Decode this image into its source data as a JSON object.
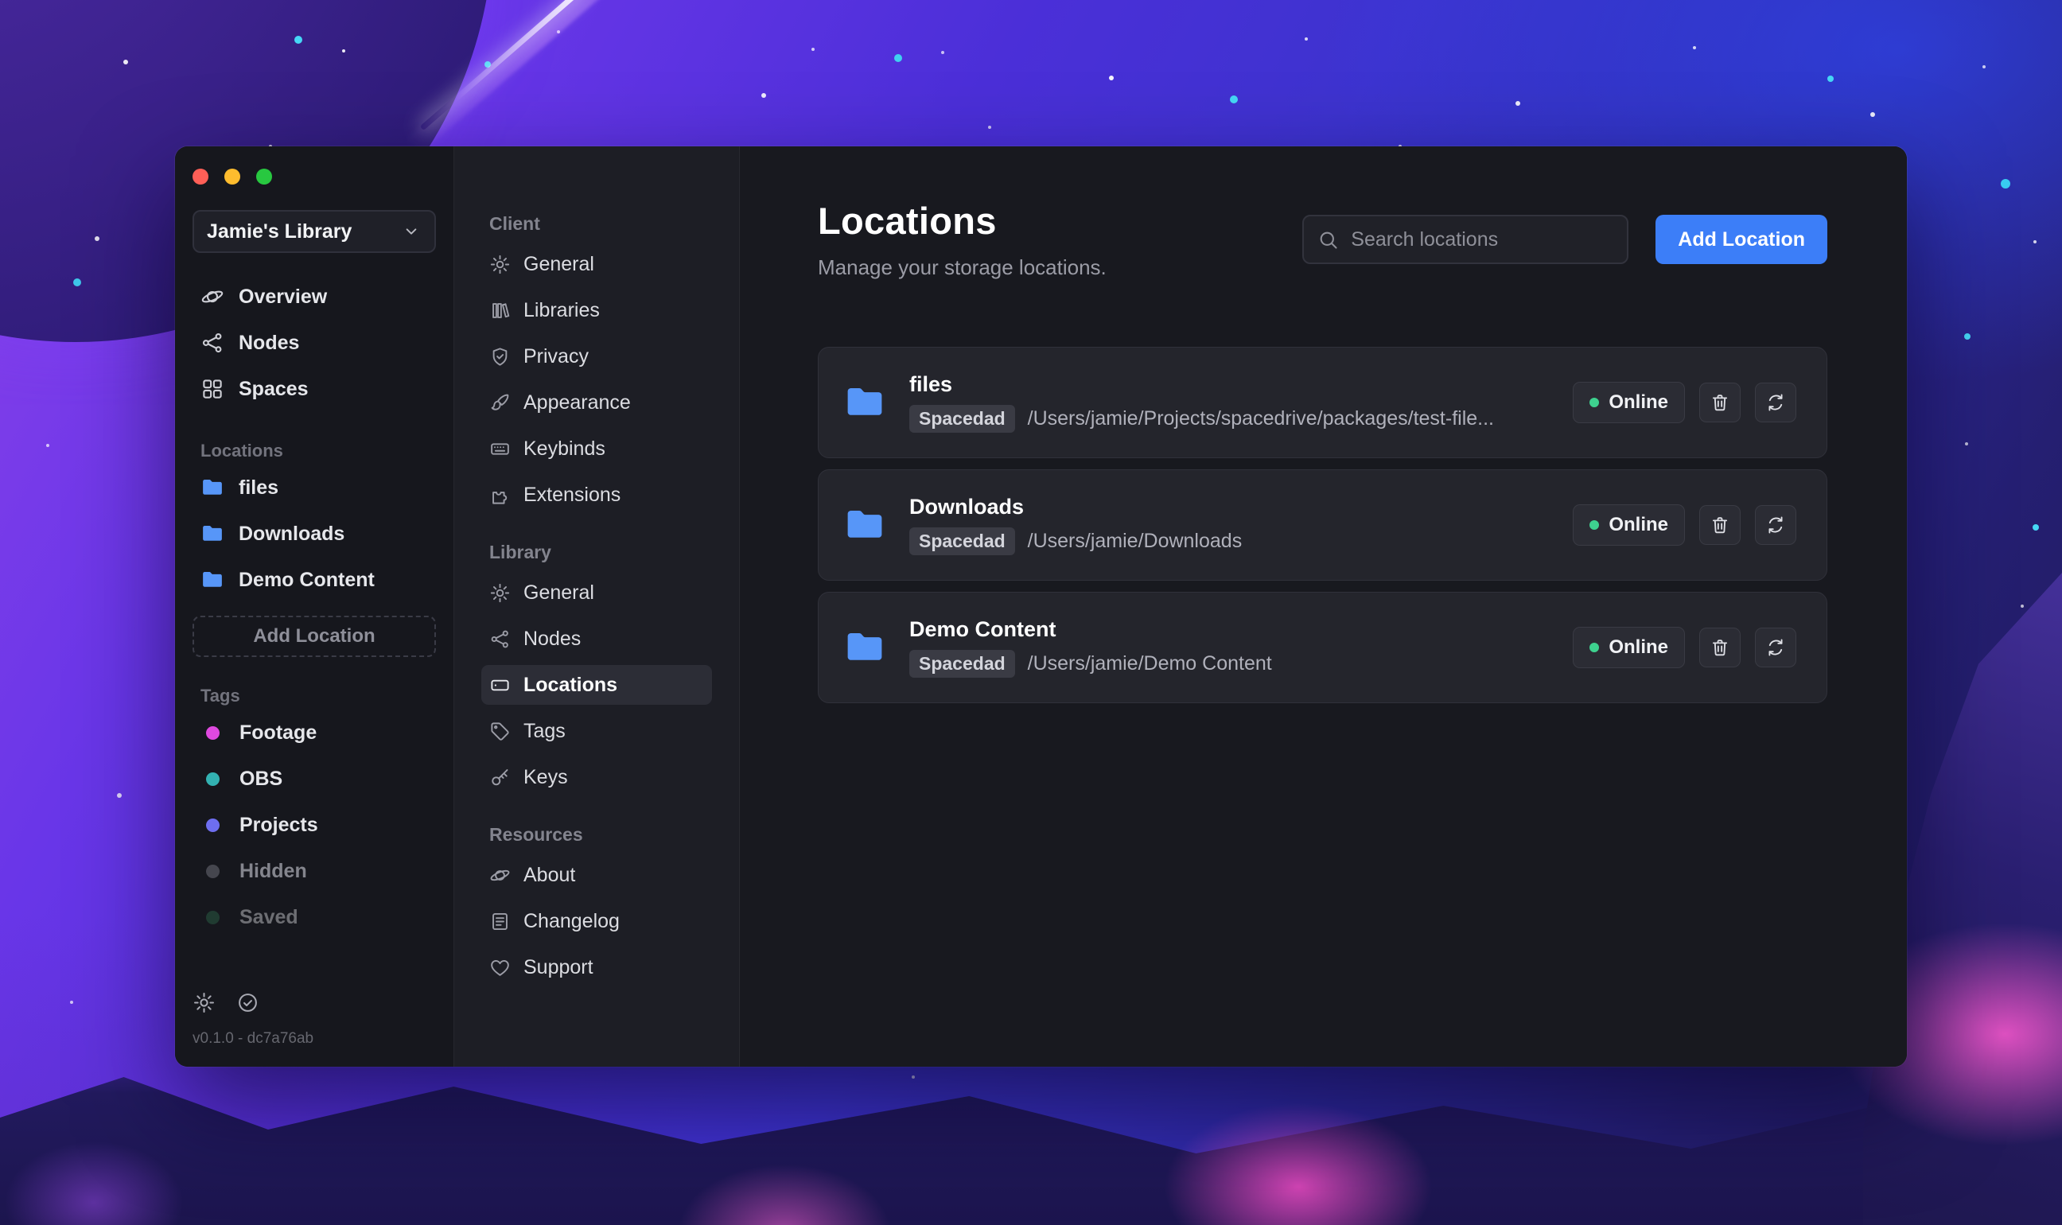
{
  "colors": {
    "accent": "#3c7ef8",
    "online_green": "#3ed18f",
    "folder_blue": "#5796f8",
    "traffic_red": "#ff5f57",
    "traffic_yellow": "#febc2e",
    "traffic_green": "#28c840"
  },
  "window": {
    "sidebar": {
      "library_selector": "Jamie's Library",
      "nav": [
        {
          "label": "Overview",
          "icon": "planet"
        },
        {
          "label": "Nodes",
          "icon": "nodes"
        },
        {
          "label": "Spaces",
          "icon": "grid"
        }
      ],
      "sections": {
        "locations": {
          "header": "Locations",
          "items": [
            "files",
            "Downloads",
            "Demo Content"
          ],
          "add_button": "Add Location"
        },
        "tags": {
          "header": "Tags",
          "items": [
            {
              "label": "Footage",
              "color": "#df49df"
            },
            {
              "label": "OBS",
              "color": "#33b2b2"
            },
            {
              "label": "Projects",
              "color": "#6e6ef0"
            },
            {
              "label": "Hidden",
              "color": "#55565f"
            },
            {
              "label": "Saved",
              "color": "#2e6e4e"
            }
          ]
        }
      },
      "version": "v0.1.0 - dc7a76ab"
    },
    "settings_nav": {
      "sections": [
        {
          "header": "Client",
          "items": [
            {
              "label": "General",
              "icon": "gear"
            },
            {
              "label": "Libraries",
              "icon": "books"
            },
            {
              "label": "Privacy",
              "icon": "shield"
            },
            {
              "label": "Appearance",
              "icon": "paintbrush"
            },
            {
              "label": "Keybinds",
              "icon": "keyboard"
            },
            {
              "label": "Extensions",
              "icon": "puzzle"
            }
          ]
        },
        {
          "header": "Library",
          "items": [
            {
              "label": "General",
              "icon": "gear"
            },
            {
              "label": "Nodes",
              "icon": "nodes"
            },
            {
              "label": "Locations",
              "icon": "drive"
            },
            {
              "label": "Tags",
              "icon": "tag"
            },
            {
              "label": "Keys",
              "icon": "key"
            }
          ]
        },
        {
          "header": "Resources",
          "items": [
            {
              "label": "About",
              "icon": "planet"
            },
            {
              "label": "Changelog",
              "icon": "changelog"
            },
            {
              "label": "Support",
              "icon": "heart"
            }
          ]
        }
      ]
    },
    "main": {
      "title": "Locations",
      "subtitle": "Manage your storage locations.",
      "search": {
        "placeholder": "Search locations"
      },
      "add_location_button": "Add Location",
      "locations": [
        {
          "name": "files",
          "node_badge": "Spacedad",
          "path": "/Users/jamie/Projects/spacedrive/packages/test-file...",
          "status": "Online"
        },
        {
          "name": "Downloads",
          "node_badge": "Spacedad",
          "path": "/Users/jamie/Downloads",
          "status": "Online"
        },
        {
          "name": "Demo Content",
          "node_badge": "Spacedad",
          "path": "/Users/jamie/Demo Content",
          "status": "Online"
        }
      ]
    }
  }
}
